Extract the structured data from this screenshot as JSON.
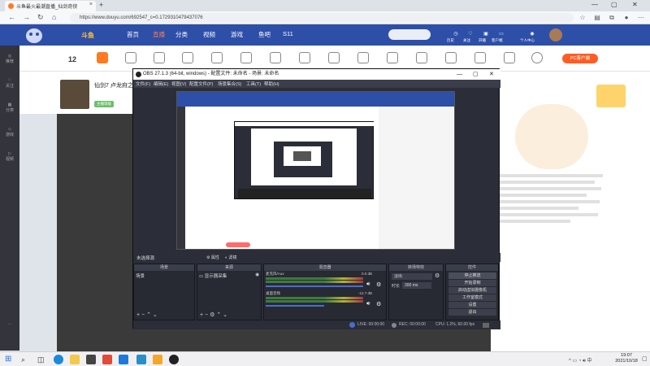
{
  "browser": {
    "tab_title": "斗鱼最火最潮直播_仙剑奇侠",
    "tab_close": "×",
    "new_tab": "+",
    "url": "https://www.douyu.com/692547_c=0.1729310479437076",
    "nav": {
      "back": "←",
      "forward": "→",
      "reload": "↻",
      "home": "⌂"
    },
    "window_controls": {
      "minimize": "—",
      "maximize": "▢",
      "close": "✕"
    },
    "toolbar_icons": [
      "favorite-icon",
      "collections-icon",
      "extensions-icon",
      "profile-icon",
      "menu-icon"
    ]
  },
  "site": {
    "logo_text": "斗鱼",
    "nav": [
      "首页",
      "直播",
      "分类",
      "视频",
      "游戏",
      "鱼吧",
      "S11"
    ],
    "right_icons": [
      "历史",
      "关注",
      "开播",
      "客户端",
      "个人中心"
    ],
    "colors": {
      "header": "#2e4fa8",
      "accent": "#ff5d23"
    }
  },
  "streamer": {
    "level": "12",
    "name": "仙剑7 卢龙府之...",
    "tag": "主播等级",
    "pc_download": "PC客户端"
  },
  "obs": {
    "title": "OBS 27.1.3 (64-bit, windows) - 配置文件: 未命名 - 场景: 未命名",
    "menu": [
      "文件(F)",
      "编辑(E)",
      "视图(V)",
      "配置文件(P)",
      "场景集合(S)",
      "工具(T)",
      "帮助(H)"
    ],
    "scene_label": "未选择源",
    "scene_buttons": [
      "属性",
      "滤镜"
    ],
    "docks": {
      "scenes": {
        "title": "场景",
        "items": [
          "场景"
        ]
      },
      "sources": {
        "title": "来源",
        "items": [
          "显示器采集"
        ]
      },
      "mixer": {
        "title": "混音器",
        "channels": [
          {
            "name": "麦克风/Aux",
            "db": "0.0 dB"
          },
          {
            "name": "桌面音频",
            "db": "-12.7 dB"
          }
        ]
      },
      "transitions": {
        "title": "转场特效",
        "type": "淡出",
        "duration_label": "时长",
        "duration": "300 ms"
      },
      "controls": {
        "title": "控件",
        "buttons": [
          "停止推流",
          "开始录制",
          "启动虚拟摄像机",
          "工作室模式",
          "设置",
          "退出"
        ]
      }
    },
    "status": {
      "live": "LIVE: 00:00:00",
      "rec": "REC: 00:00:00",
      "cpu": "CPU: 1.2%, 60.00 fps"
    }
  },
  "taskbar": {
    "time": "19:07",
    "date": "2021/10/18",
    "apps": [
      "start-icon",
      "search-icon",
      "task-view-icon",
      "edge-icon",
      "explorer-icon",
      "store-icon",
      "mail-icon",
      "app-icon",
      "app-icon",
      "app-icon",
      "obs-icon"
    ]
  }
}
